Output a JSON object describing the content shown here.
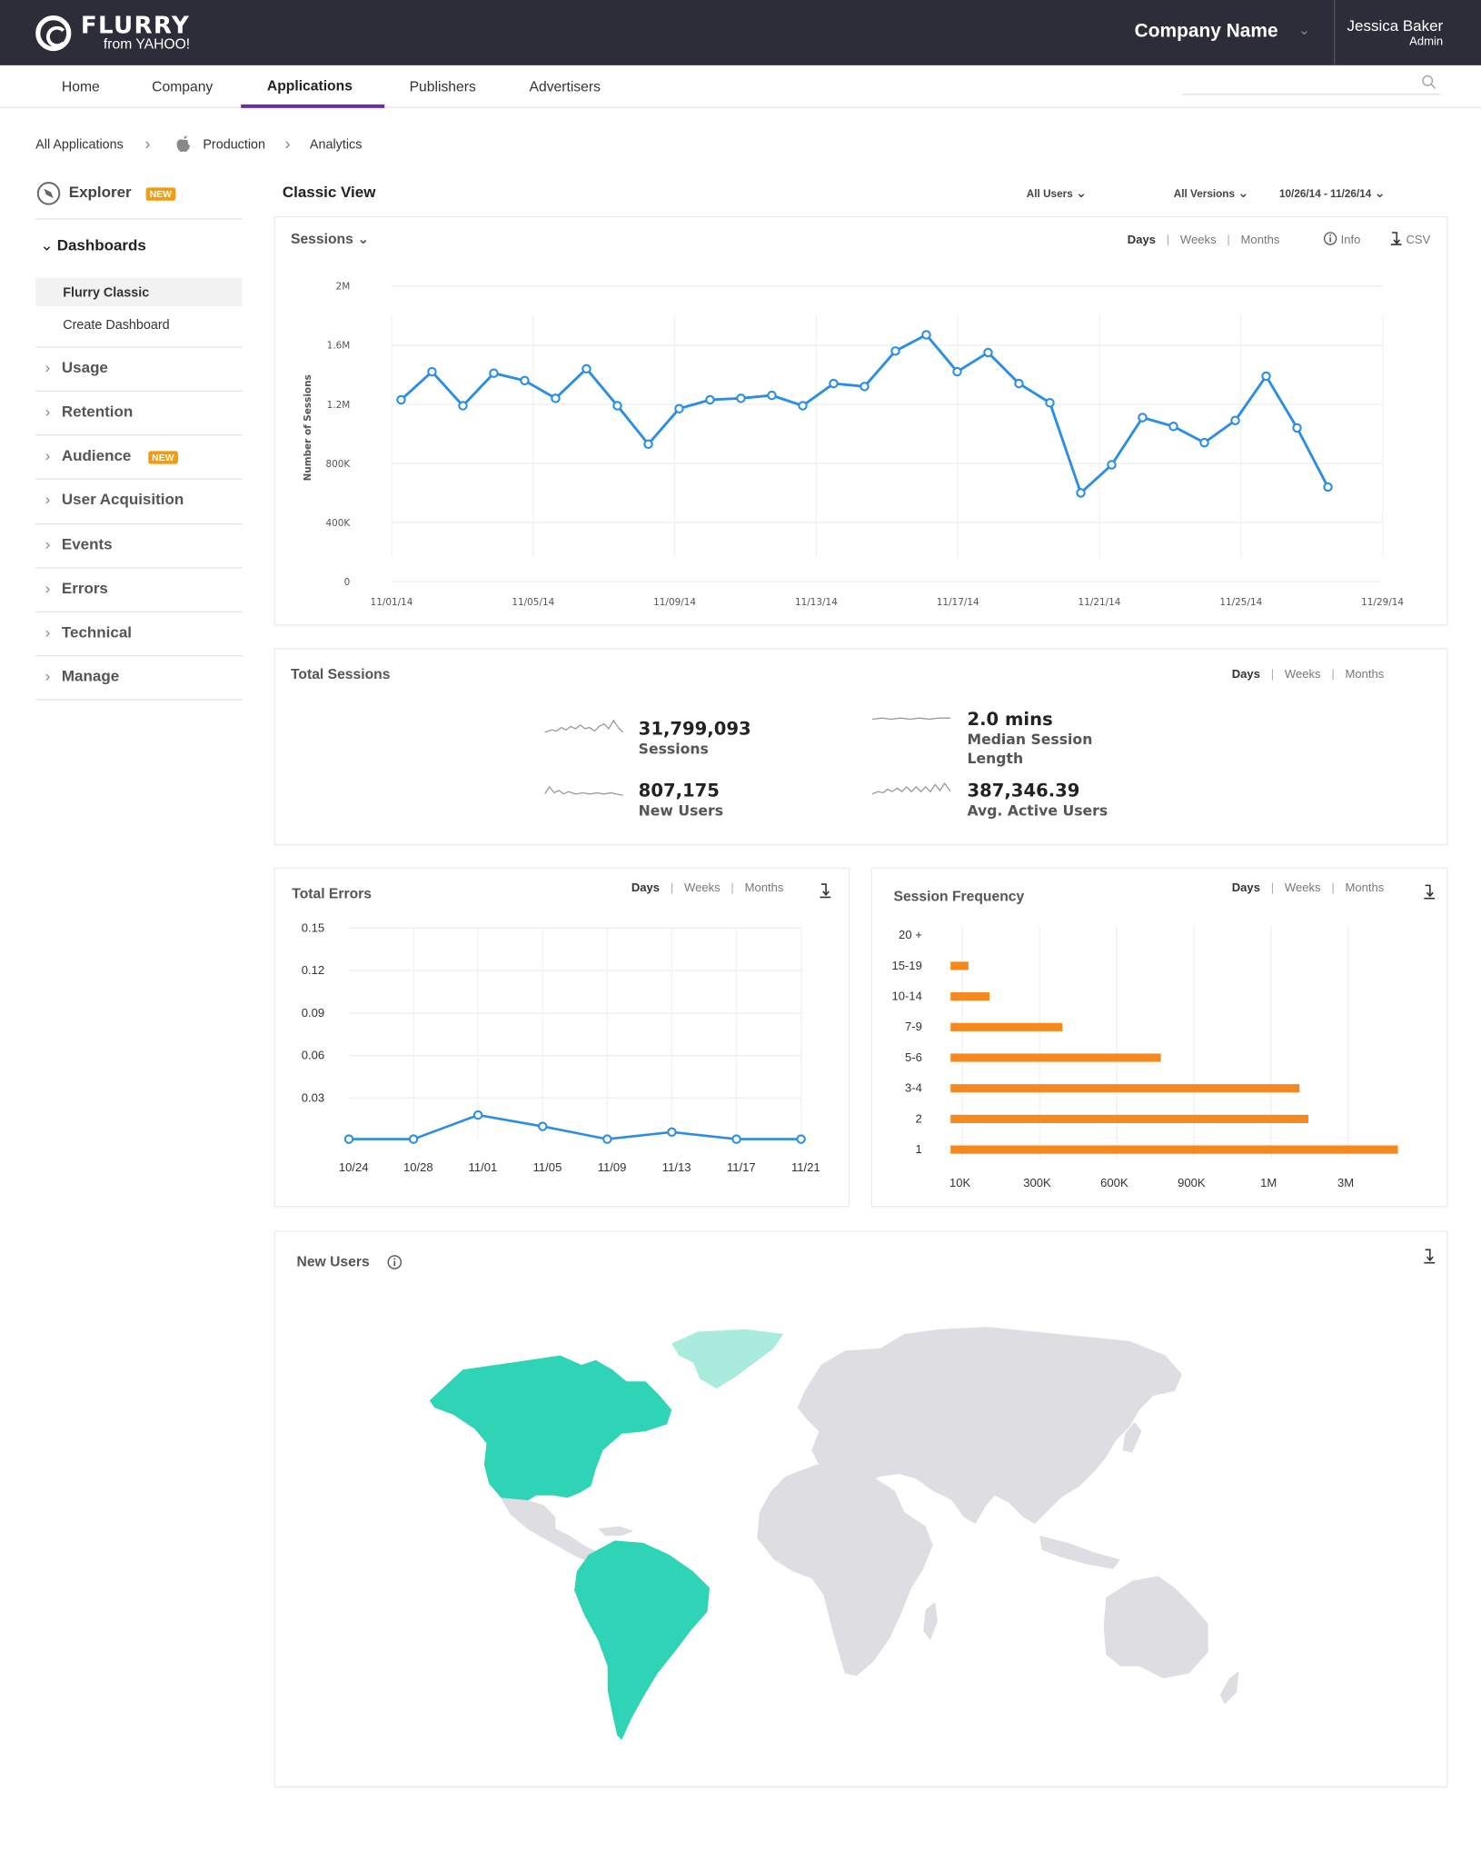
{
  "header": {
    "brand": "FLURRY",
    "brand_sub": "from YAHOO!",
    "company": "Company Name",
    "user_name": "Jessica Baker",
    "user_role": "Admin"
  },
  "nav": {
    "items": [
      "Home",
      "Company",
      "Applications",
      "Publishers",
      "Advertisers"
    ],
    "active": "Applications"
  },
  "breadcrumb": [
    "All Applications",
    "Production",
    "Analytics"
  ],
  "sidebar": {
    "explorer": "Explorer",
    "new_badge": "NEW",
    "dashboards": "Dashboards",
    "dash_items": [
      "Flurry Classic",
      "Create Dashboard"
    ],
    "sections": [
      "Usage",
      "Retention",
      "Audience",
      "User Acquisition",
      "Events",
      "Errors",
      "Technical",
      "Manage"
    ]
  },
  "view": {
    "title": "Classic View",
    "users_filter": "All Users",
    "versions_filter": "All Versions",
    "date_range": "10/26/14 - 11/26/14"
  },
  "toggle": {
    "days": "Days",
    "weeks": "Weeks",
    "months": "Months"
  },
  "sessions": {
    "title": "Sessions",
    "info": "Info",
    "csv": "CSV"
  },
  "total_sessions": {
    "title": "Total Sessions",
    "stats": [
      {
        "value": "31,799,093",
        "label": "Sessions"
      },
      {
        "value": "2.0 mins",
        "label": "Median Session Length"
      },
      {
        "value": "807,175",
        "label": "New Users"
      },
      {
        "value": "387,346.39",
        "label": "Avg. Active Users"
      }
    ]
  },
  "total_errors": {
    "title": "Total Errors"
  },
  "session_frequency": {
    "title": "Session Frequency"
  },
  "new_users": {
    "title": "New Users"
  },
  "colors": {
    "topbar": "#2d2d3a",
    "nav_active": "#6a2bb3",
    "line_blue": "#2b8de3",
    "bar_orange": "#f5891f",
    "map_teal": "#2fd3b5",
    "map_light_teal": "#a9ebdd",
    "map_gray": "#dedde2",
    "badge_orange": "#f39c12"
  },
  "chart_data": [
    {
      "type": "line",
      "title": "Sessions",
      "ylabel": "Number of Sessions",
      "xlabel": "",
      "x_ticks": [
        "11/01/14",
        "11/05/14",
        "11/09/14",
        "11/13/14",
        "11/17/14",
        "11/21/14",
        "11/25/14",
        "11/29/14"
      ],
      "y_ticks": [
        "0",
        "400K",
        "800K",
        "1.2M",
        "1.6M",
        "2M"
      ],
      "ylim": [
        0,
        2000000
      ],
      "series": [
        {
          "values": [
            1230000,
            1420000,
            1190000,
            1410000,
            1360000,
            1240000,
            1440000,
            1190000,
            930000,
            1170000,
            1230000,
            1240000,
            1260000,
            1190000,
            1340000,
            1320000,
            1560000,
            1670000,
            1420000,
            1550000,
            1340000,
            1210000,
            600000,
            790000,
            1110000,
            1050000,
            940000,
            1090000,
            1390000,
            1040000,
            640000
          ]
        }
      ]
    },
    {
      "type": "line",
      "title": "Total Errors",
      "categories": [
        "10/24",
        "10/28",
        "11/01",
        "11/05",
        "11/09",
        "11/13",
        "11/17",
        "11/21"
      ],
      "y_ticks": [
        "0.03",
        "0.06",
        "0.09",
        "0.12",
        "0.15"
      ],
      "ylim": [
        0,
        0.15
      ],
      "series": [
        {
          "values": [
            0.001,
            0.001,
            0.018,
            0.01,
            0.001,
            0.006,
            0.001,
            0.001
          ]
        }
      ]
    },
    {
      "type": "bar",
      "orientation": "horizontal",
      "title": "Session Frequency",
      "categories": [
        "20 +",
        "15-19",
        "10-14",
        "7-9",
        "5-6",
        "3-4",
        "2",
        "1"
      ],
      "x_ticks": [
        "10K",
        "300K",
        "600K",
        "900K",
        "1M",
        "3M"
      ],
      "values_fraction_of_axis": [
        0,
        0.04,
        0.087,
        0.25,
        0.47,
        0.78,
        0.8,
        1.0
      ]
    }
  ]
}
